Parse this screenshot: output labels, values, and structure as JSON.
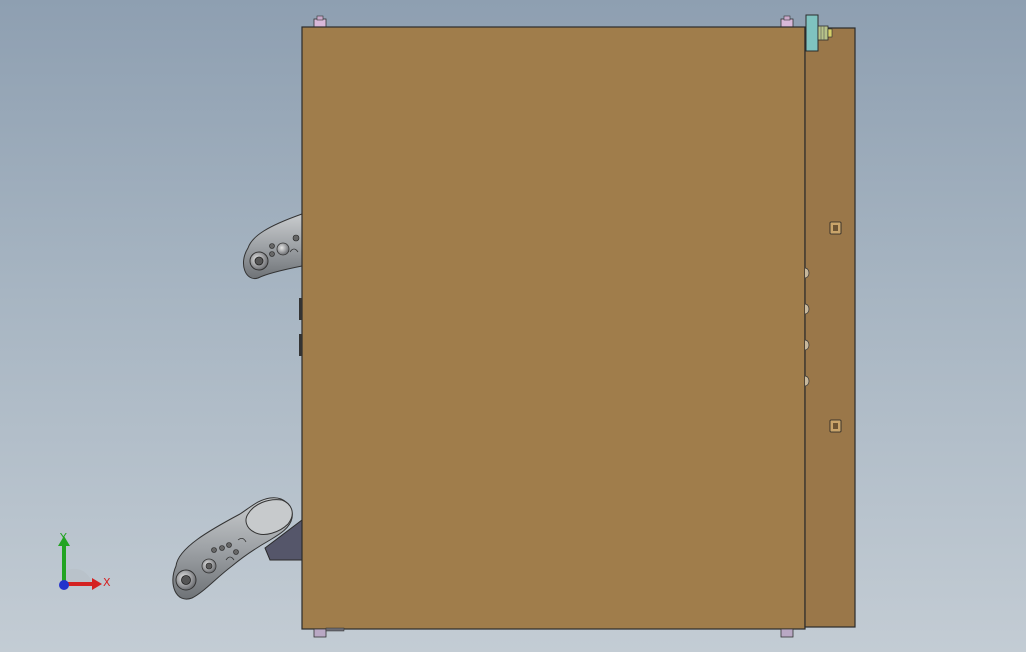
{
  "viewport": {
    "background_top": "#8e9fb1",
    "background_bottom": "#c3ccd4"
  },
  "model": {
    "main_panel_color": "#a07d4b",
    "side_panel_color": "#9a7749",
    "edge_color": "#2b2b2b",
    "handle_color": "#9a9ea2",
    "bracket_color": "#5a5a6a"
  },
  "triad": {
    "x_label": "X",
    "y_label": "Y",
    "x_color": "#d42222",
    "y_color": "#22a422",
    "z_color": "#2233cc"
  }
}
